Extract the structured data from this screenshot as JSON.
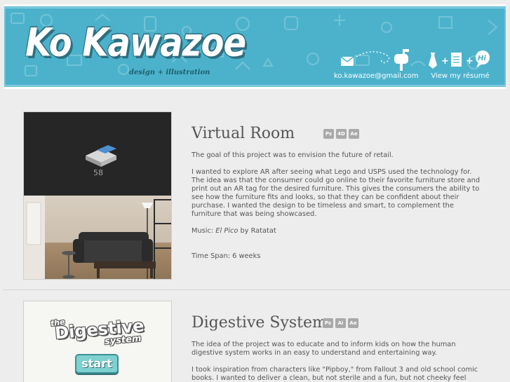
{
  "header": {
    "logo_name": "Ko Kawazoe",
    "logo_tagline": "design + illustration",
    "email": {
      "label": "ko.kawazoe@gmail.com",
      "icons": [
        "envelope-icon",
        "dotted-path-icon",
        "mailbox-icon"
      ]
    },
    "resume": {
      "label": "View my résumé",
      "icons": [
        "necktie-icon",
        "plus-icon",
        "document-icon",
        "plus-icon",
        "hi-speech-bubble-icon"
      ]
    }
  },
  "projects": [
    {
      "title": "Virtual Room",
      "badges": [
        "Ps",
        "4D",
        "Ae"
      ],
      "thumb_counter": "58",
      "paragraphs": [
        "The goal of this project was to envision the future of retail.",
        "I wanted to explore AR after seeing what Lego and USPS used the technology for. The idea was that the consumer could go online to their favorite furniture store and print out an AR tag for the desired furniture. This gives the consumers the ability to see how the furniture fits and looks, so that they can be confident about their purchase. I wanted the design to be timeless and smart, to complement the furniture that was being showcased."
      ],
      "music_prefix": "Music: ",
      "music_title": "El Pico",
      "music_suffix": " by Ratatat",
      "time_span": "Time Span: 6 weeks"
    },
    {
      "title": "Digestive System",
      "badges": [
        "Ps",
        "Ai",
        "Ae"
      ],
      "thumb_title_the": "the",
      "thumb_title_main": "Digestive",
      "thumb_title_sub": "system",
      "thumb_button": "start",
      "paragraphs": [
        "The idea of the project was to educate and to inform kids on how the human digestive system works in an easy to understand and entertaining way.",
        "I took inspiration from characters like \"Pipboy,\" from Fallout 3 and old school comic books. I wanted to deliver a clean, but not sterile and a fun, but not cheeky feel over"
      ]
    }
  ],
  "colors": {
    "banner": "#4cb2cc",
    "text": "#555555",
    "badge": "#a9a9a9",
    "background": "#ededed"
  }
}
